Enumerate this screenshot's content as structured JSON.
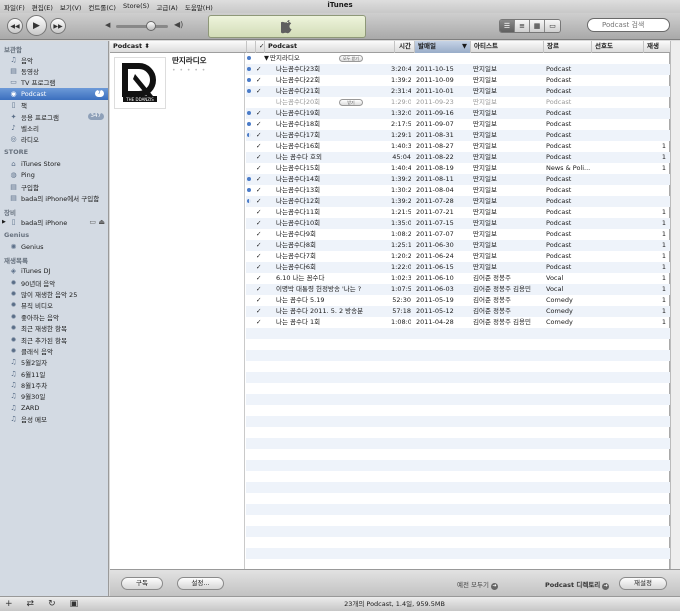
{
  "window": {
    "title": "iTunes"
  },
  "menu": [
    "파일(F)",
    "편집(E)",
    "보기(V)",
    "컨트롤(C)",
    "Store(S)",
    "고급(A)",
    "도움말(H)"
  ],
  "search": {
    "placeholder": "Podcast 검색"
  },
  "sidebar": {
    "sections": [
      {
        "header": "보관함",
        "items": [
          {
            "label": "음악",
            "icon": "music-note-icon"
          },
          {
            "label": "동영상",
            "icon": "film-icon"
          },
          {
            "label": "TV 프로그램",
            "icon": "tv-icon"
          },
          {
            "label": "Podcast",
            "icon": "podcast-icon",
            "selected": true,
            "badge": "7"
          },
          {
            "label": "책",
            "icon": "book-icon"
          },
          {
            "label": "응용 프로그램",
            "icon": "apps-icon",
            "badge": "347"
          },
          {
            "label": "벨소리",
            "icon": "bell-icon"
          },
          {
            "label": "라디오",
            "icon": "radio-icon"
          }
        ]
      },
      {
        "header": "STORE",
        "items": [
          {
            "label": "iTunes Store",
            "icon": "store-icon"
          },
          {
            "label": "Ping",
            "icon": "ping-icon"
          },
          {
            "label": "구입함",
            "icon": "purchased-icon"
          },
          {
            "label": "bada의 iPhone에서 구입함",
            "icon": "purchased-icon"
          }
        ]
      },
      {
        "header": "장비",
        "items": [
          {
            "label": "bada의 iPhone",
            "icon": "iphone-icon",
            "device": true
          }
        ]
      },
      {
        "header": "Genius",
        "items": [
          {
            "label": "Genius",
            "icon": "genius-icon"
          }
        ]
      },
      {
        "header": "재생목록",
        "items": [
          {
            "label": "iTunes DJ",
            "icon": "dj-icon"
          },
          {
            "label": "90년대 음악",
            "icon": "gear-icon"
          },
          {
            "label": "많이 재생한 음악 25",
            "icon": "gear-icon"
          },
          {
            "label": "뮤직 비디오",
            "icon": "gear-icon"
          },
          {
            "label": "좋아하는 음악",
            "icon": "gear-icon"
          },
          {
            "label": "최근 재생한 항목",
            "icon": "gear-icon"
          },
          {
            "label": "최근 추가된 항목",
            "icon": "gear-icon"
          },
          {
            "label": "클래식 음악",
            "icon": "gear-icon"
          },
          {
            "label": "5월2일자",
            "icon": "playlist-icon"
          },
          {
            "label": "6월11일",
            "icon": "playlist-icon"
          },
          {
            "label": "8월1주차",
            "icon": "playlist-icon"
          },
          {
            "label": "9월30일",
            "icon": "playlist-icon"
          },
          {
            "label": "ZARD",
            "icon": "playlist-icon"
          },
          {
            "label": "음성 메모",
            "icon": "playlist-icon"
          }
        ]
      }
    ]
  },
  "columns": {
    "podcast": "Podcast",
    "episode": "Podcast",
    "time": "시간",
    "date": "발매일",
    "artist": "아티스트",
    "genre": "장르",
    "rating": "선호도",
    "plays": "재생"
  },
  "podcast": {
    "name": "딴지라디오",
    "group_label": "딴지라디오"
  },
  "episodes": [
    {
      "name": "나는꼼수다23회",
      "time": "3:20:48",
      "date": "2011-10-15",
      "artist": "딴지일보",
      "genre": "Podcast",
      "plays": "",
      "dot": "full",
      "check": true
    },
    {
      "name": "나는꼼수다22회",
      "time": "1:39:24",
      "date": "2011-10-09",
      "artist": "딴지일보",
      "genre": "Podcast",
      "plays": "",
      "dot": "full",
      "check": true
    },
    {
      "name": "나는꼼수다21회",
      "time": "2:31:47",
      "date": "2011-10-01",
      "artist": "딴지일보",
      "genre": "Podcast",
      "plays": "",
      "dot": "full",
      "check": true
    },
    {
      "name": "나는꼼수다20회",
      "time": "1:29:03",
      "date": "2011-09-23",
      "artist": "딴지일보",
      "genre": "Podcast",
      "plays": "",
      "dot": "none",
      "check": false,
      "dim": true,
      "pill": "받기"
    },
    {
      "name": "나는꼼수다19회",
      "time": "1:32:04",
      "date": "2011-09-16",
      "artist": "딴지일보",
      "genre": "Podcast",
      "plays": "",
      "dot": "full",
      "check": true
    },
    {
      "name": "나는꼼수다18회",
      "time": "2:17:53",
      "date": "2011-09-07",
      "artist": "딴지일보",
      "genre": "Podcast",
      "plays": "",
      "dot": "full",
      "check": true
    },
    {
      "name": "나는꼼수다17회",
      "time": "1:29:18",
      "date": "2011-08-31",
      "artist": "딴지일보",
      "genre": "Podcast",
      "plays": "",
      "dot": "half",
      "check": true
    },
    {
      "name": "나는꼼수다16회",
      "time": "1:40:34",
      "date": "2011-08-27",
      "artist": "딴지일보",
      "genre": "Podcast",
      "plays": "1",
      "dot": "none",
      "check": true
    },
    {
      "name": "나는 꼼수다 호외",
      "time": "45:04",
      "date": "2011-08-22",
      "artist": "딴지일보",
      "genre": "Podcast",
      "plays": "1",
      "dot": "none",
      "check": true
    },
    {
      "name": "나는꼼수다15회",
      "time": "1:40:40",
      "date": "2011-08-19",
      "artist": "딴지일보",
      "genre": "News & Poli...",
      "plays": "1",
      "dot": "none",
      "check": true
    },
    {
      "name": "나는꼼수다14회",
      "time": "1:39:26",
      "date": "2011-08-11",
      "artist": "딴지일보",
      "genre": "Podcast",
      "plays": "",
      "dot": "full",
      "check": true
    },
    {
      "name": "나는꼼수다13회",
      "time": "1:30:21",
      "date": "2011-08-04",
      "artist": "딴지일보",
      "genre": "Podcast",
      "plays": "",
      "dot": "full",
      "check": true
    },
    {
      "name": "나는꼼수다12회",
      "time": "1:39:26",
      "date": "2011-07-28",
      "artist": "딴지일보",
      "genre": "Podcast",
      "plays": "",
      "dot": "half",
      "check": true
    },
    {
      "name": "나는꼼수다11회",
      "time": "1:21:55",
      "date": "2011-07-21",
      "artist": "딴지일보",
      "genre": "Podcast",
      "plays": "1",
      "dot": "none",
      "check": true
    },
    {
      "name": "나는꼼수다10회",
      "time": "1:35:06",
      "date": "2011-07-15",
      "artist": "딴지일보",
      "genre": "Podcast",
      "plays": "1",
      "dot": "none",
      "check": true
    },
    {
      "name": "나는꼼수다9회",
      "time": "1:08:20",
      "date": "2011-07-07",
      "artist": "딴지일보",
      "genre": "Podcast",
      "plays": "1",
      "dot": "none",
      "check": true
    },
    {
      "name": "나는꼼수다8회",
      "time": "1:25:13",
      "date": "2011-06-30",
      "artist": "딴지일보",
      "genre": "Podcast",
      "plays": "1",
      "dot": "none",
      "check": true
    },
    {
      "name": "나는꼼수다7회",
      "time": "1:20:24",
      "date": "2011-06-24",
      "artist": "딴지일보",
      "genre": "Podcast",
      "plays": "1",
      "dot": "none",
      "check": true
    },
    {
      "name": "나는꼼수다6회",
      "time": "1:22:04",
      "date": "2011-06-15",
      "artist": "딴지일보",
      "genre": "Podcast",
      "plays": "1",
      "dot": "none",
      "check": true
    },
    {
      "name": "6.10 나는 꼼수다",
      "time": "1:02:31",
      "date": "2011-06-10",
      "artist": "김어준 정봉주",
      "genre": "Vocal",
      "plays": "1",
      "dot": "none",
      "check": true
    },
    {
      "name": "이명박 대통령 헌정방송 '나는 ?",
      "time": "1:07:51",
      "date": "2011-06-03",
      "artist": "김어준 정봉주 김용민",
      "genre": "Vocal",
      "plays": "1",
      "dot": "none",
      "check": true
    },
    {
      "name": "나는 꼼수다 5.19",
      "time": "52:30",
      "date": "2011-05-19",
      "artist": "김어준 정봉주",
      "genre": "Comedy",
      "plays": "1",
      "dot": "none",
      "check": true
    },
    {
      "name": "나는 꼼수다 2011. 5. 2 방송분",
      "time": "57:18",
      "date": "2011-05-12",
      "artist": "김어준 정봉주",
      "genre": "Comedy",
      "plays": "1",
      "dot": "none",
      "check": true
    },
    {
      "name": "나는 꼼수다 1회",
      "time": "1:08:01",
      "date": "2011-04-28",
      "artist": "김어준 정봉주 김용민",
      "genre": "Comedy",
      "plays": "1",
      "dot": "none",
      "check": true
    }
  ],
  "group_pill": "모두 받기",
  "bottom": {
    "subscribe": "구독",
    "settings": "설정...",
    "browse": "예전 모두기",
    "directory": "Podcast 디렉토리",
    "refresh": "재설정"
  },
  "status": "23개의 Podcast, 1.4일, 959.5MB"
}
